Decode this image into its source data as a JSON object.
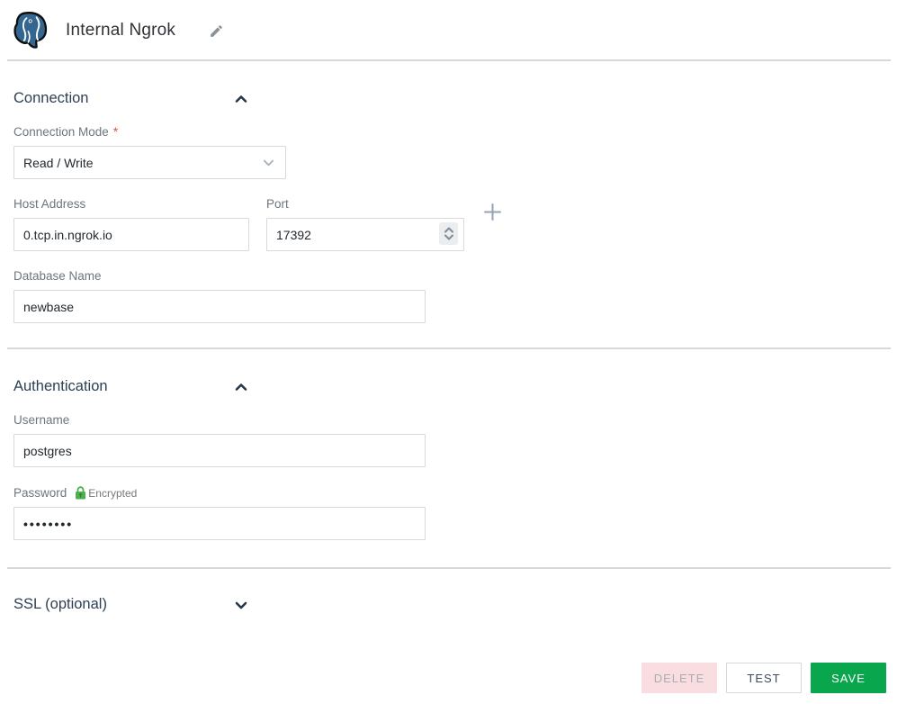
{
  "header": {
    "title": "Internal Ngrok"
  },
  "connection": {
    "title": "Connection",
    "mode_label": "Connection Mode",
    "required_mark": "*",
    "mode_value": "Read / Write",
    "host_label": "Host Address",
    "host_value": "0.tcp.in.ngrok.io",
    "port_label": "Port",
    "port_value": "17392",
    "db_label": "Database Name",
    "db_value": "newbase"
  },
  "authentication": {
    "title": "Authentication",
    "username_label": "Username",
    "username_value": "postgres",
    "password_label": "Password",
    "encrypted_badge": "Encrypted",
    "password_value": "••••••••"
  },
  "ssl": {
    "title": "SSL (optional)"
  },
  "footer": {
    "delete_label": "DELETE",
    "test_label": "TEST",
    "save_label": "SAVE"
  },
  "colors": {
    "postgres_blue": "#336791",
    "save_green": "#0aa64e",
    "delete_pink_bg": "#fadde0",
    "section_heading": "#2e4053",
    "label_gray": "#6a7680",
    "required_red": "#e74c3c",
    "encrypted_green": "#4caf50",
    "divider_gray": "#d4d8dc",
    "input_border": "#d9d9d9"
  }
}
